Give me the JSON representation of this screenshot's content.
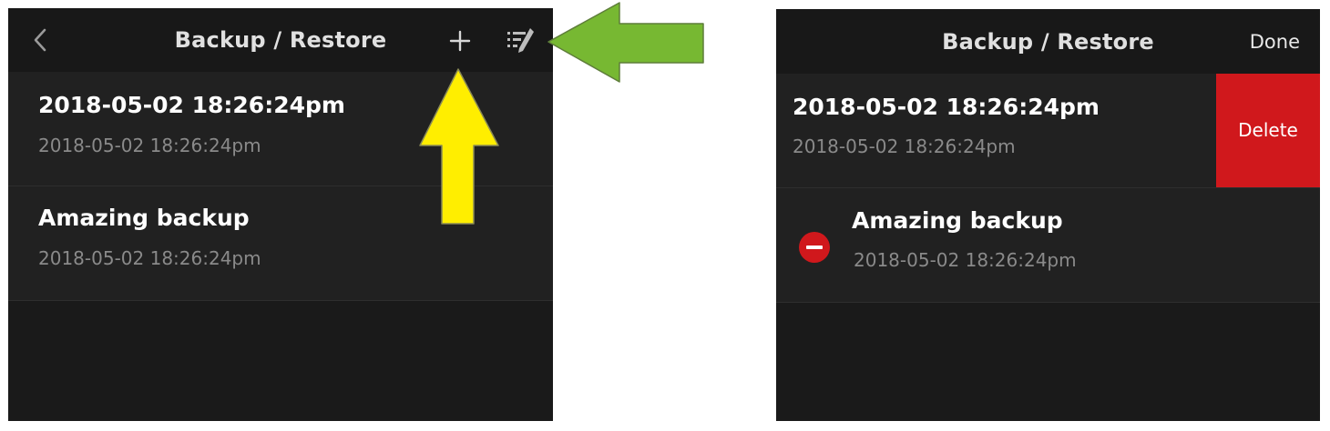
{
  "left_screen": {
    "title": "Backup / Restore",
    "back_icon": "chevron-left-icon",
    "add_icon": "plus-icon",
    "edit_icon": "edit-list-icon",
    "items": [
      {
        "title": "2018-05-02 18:26:24pm",
        "subtitle": "2018-05-02 18:26:24pm"
      },
      {
        "title": "Amazing backup",
        "subtitle": "2018-05-02 18:26:24pm"
      }
    ]
  },
  "right_screen": {
    "title": "Backup / Restore",
    "done_label": "Done",
    "delete_label": "Delete",
    "delete_icon": "minus-circle-icon",
    "items": [
      {
        "title": "2018-05-02 18:26:24pm",
        "subtitle": "2018-05-02 18:26:24pm"
      },
      {
        "title": "Amazing backup",
        "subtitle": "2018-05-02 18:26:24pm"
      }
    ]
  },
  "annotations": {
    "yellow_arrow": "arrow-up-icon",
    "green_arrow": "arrow-left-icon"
  },
  "colors": {
    "background": "#1a1a1a",
    "row": "#212121",
    "delete": "#d0181c",
    "yellow_arrow": "#ffee00",
    "green_arrow": "#77b832"
  }
}
